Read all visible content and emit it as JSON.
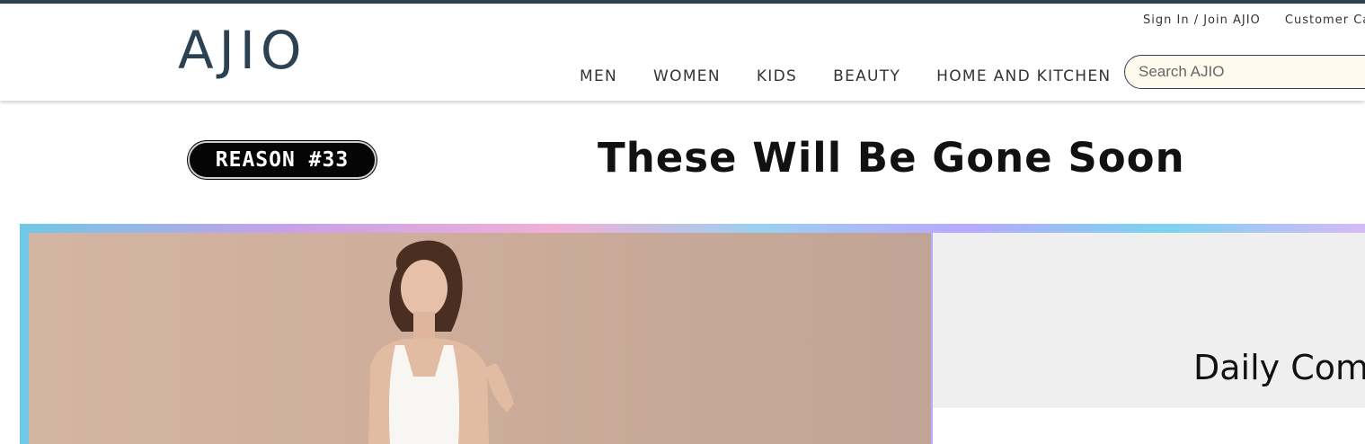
{
  "header": {
    "logo_text": "AJIO",
    "util_links": [
      "Sign In / Join AJIO",
      "Customer Care"
    ],
    "nav": [
      "MEN",
      "WOMEN",
      "KIDS",
      "BEAUTY",
      "HOME AND KITCHEN"
    ],
    "search_placeholder": "Search AJIO"
  },
  "promo": {
    "badge": "REASON #33",
    "headline": "These Will Be Gone Soon"
  },
  "banner": {
    "side_title": "Daily Comfort"
  },
  "colors": {
    "brand": "#2c4152",
    "search_bg": "#fefaee"
  }
}
